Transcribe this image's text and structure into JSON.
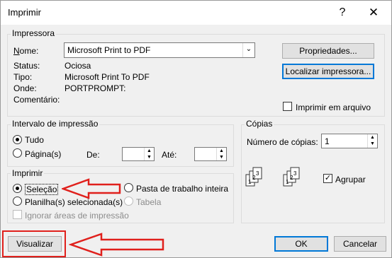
{
  "window": {
    "title": "Imprimir",
    "help_glyph": "?",
    "close_glyph": "✕"
  },
  "printer": {
    "group_label": "Impressora",
    "name_label": "Nome:",
    "name_value": "Microsoft Print to PDF",
    "status_label": "Status:",
    "status_value": "Ociosa",
    "type_label": "Tipo:",
    "type_value": "Microsoft Print To PDF",
    "where_label": "Onde:",
    "where_value": "PORTPROMPT:",
    "comment_label": "Comentário:",
    "properties_button": "Propriedades...",
    "find_button": "Localizar impressora...",
    "print_to_file_label": "Imprimir em arquivo",
    "print_to_file_checked": false
  },
  "range": {
    "group_label": "Intervalo de impressão",
    "all_label": "Tudo",
    "all_selected": true,
    "pages_label": "Página(s)",
    "from_label": "De:",
    "from_value": "",
    "to_label": "Até:",
    "to_value": ""
  },
  "copies": {
    "group_label": "Cópias",
    "count_label": "Número de cópias:",
    "count_value": "1",
    "collate_label": "Agrupar",
    "collate_checked": true
  },
  "print_what": {
    "group_label": "Imprimir",
    "selection_label": "Seleção",
    "selection_selected": true,
    "entire_workbook_label": "Pasta de trabalho inteira",
    "active_sheets_label": "Planilha(s) selecionada(s)",
    "table_label": "Tabela",
    "ignore_print_areas_label": "Ignorar áreas de impressão"
  },
  "footer": {
    "preview_button": "Visualizar",
    "ok_button": "OK",
    "cancel_button": "Cancelar"
  },
  "annotation": {
    "color": "#e0201c"
  },
  "icons": [
    "question-icon",
    "close-icon",
    "dropdown-arrow-icon",
    "spin-arrows-icon",
    "collated-pages-icon",
    "arrow-annotation-icon"
  ]
}
